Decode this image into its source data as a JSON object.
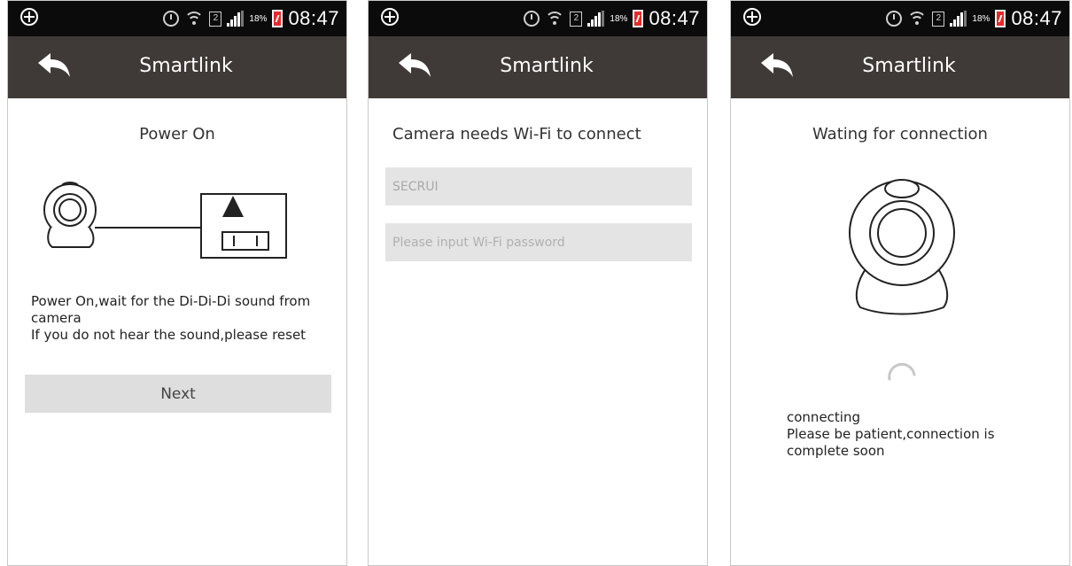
{
  "status_bar": {
    "sim_slot": "2",
    "battery_pct": "18%",
    "time": "08:47",
    "icons": [
      "location-plus-icon",
      "alarm-icon",
      "wifi-icon",
      "sim-icon",
      "signal-icon",
      "battery-icon"
    ]
  },
  "screens": [
    {
      "title": "Smartlink",
      "heading": "Power On",
      "instructions": [
        "Power On,wait for the Di-Di-Di sound from camera",
        "If you do not hear the sound,please reset"
      ],
      "next_label": "Next"
    },
    {
      "title": "Smartlink",
      "heading": "Camera needs Wi-Fi to connect",
      "ssid_value": "SECRUI",
      "password_placeholder": "Please input Wi-Fi password"
    },
    {
      "title": "Smartlink",
      "heading": "Wating for connection",
      "status": "connecting",
      "message": "Please be patient,connection is complete soon"
    }
  ],
  "colors": {
    "status_bar": "#0b0b0b",
    "nav_bar": "#3f3a37",
    "button": "#dedede",
    "input": "#e4e4e4",
    "battery": "#e52b2b"
  }
}
